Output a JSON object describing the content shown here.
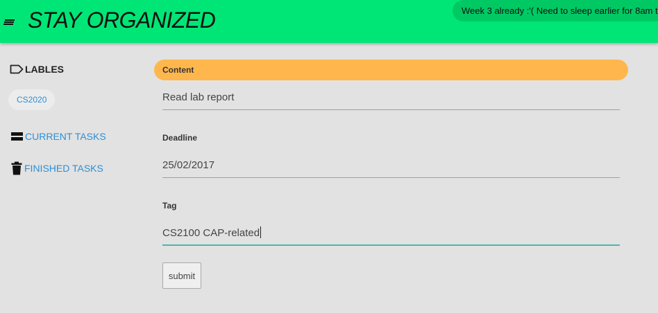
{
  "app": {
    "title": "STAY ORGANIZED",
    "notification": "Week 3 already :'( Need to sleep earlier for 8am tu",
    "colors": {
      "appbar": "#00e676",
      "accent_blue": "#2d8fd5",
      "content_header": "#ffb74d",
      "focus_underline": "#4db6ac"
    }
  },
  "sidebar": {
    "heading": "LABLES",
    "heading_icon": "label-icon",
    "labels": [
      "CS2020"
    ],
    "nav": [
      {
        "label": "CURRENT TASKS",
        "icon": "list-icon"
      },
      {
        "label": "FINISHED TASKS",
        "icon": "trash-icon"
      }
    ]
  },
  "form": {
    "content_header": "Content",
    "content_value": "Read lab report",
    "deadline_label": "Deadline",
    "deadline_value": "25/02/2017",
    "tag_label": "Tag",
    "tag_value": "CS2100 CAP-related",
    "submit_label": "submit"
  }
}
